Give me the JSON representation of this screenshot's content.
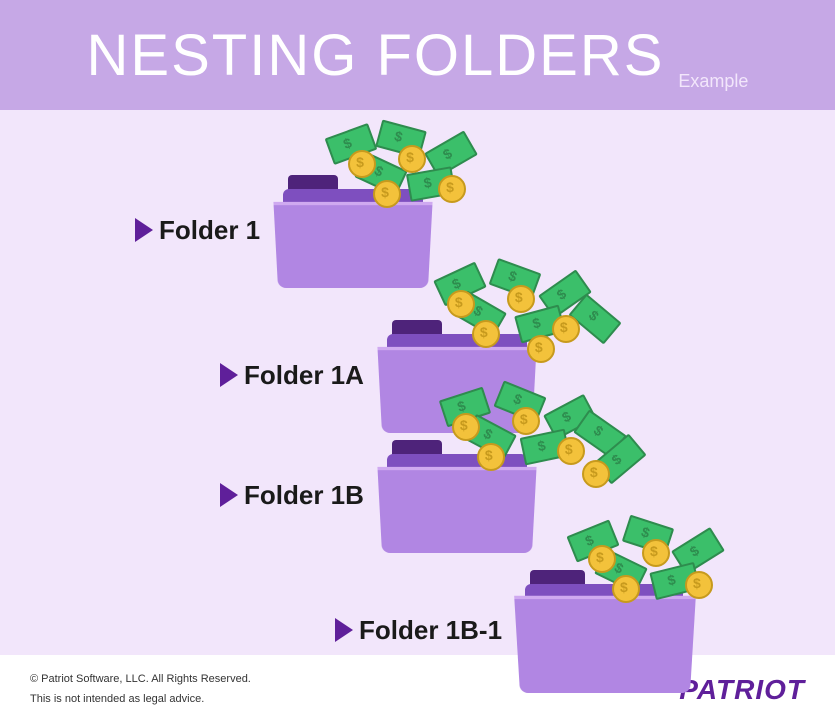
{
  "header": {
    "title": "NESTING FOLDERS",
    "subtitle": "Example"
  },
  "folders": [
    {
      "label": "Folder 1"
    },
    {
      "label": "Folder 1A"
    },
    {
      "label": "Folder 1B"
    },
    {
      "label": "Folder 1B-1"
    }
  ],
  "footer": {
    "copyright": "© Patriot Software, LLC. All Rights Reserved.",
    "disclaimer": "This is not intended as legal advice.",
    "brand": "PATRIOT"
  }
}
